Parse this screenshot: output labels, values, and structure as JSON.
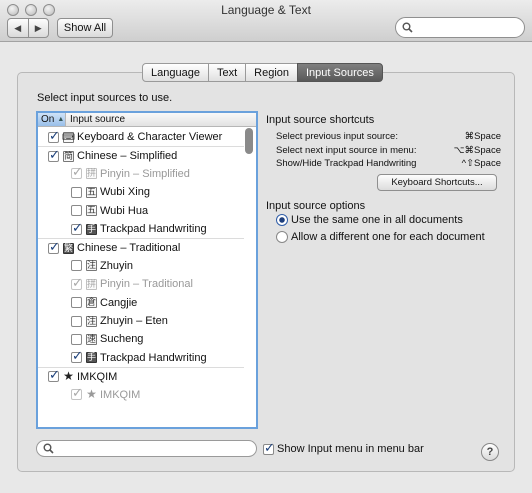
{
  "window": {
    "title": "Language & Text"
  },
  "toolbar": {
    "back_icon": "◀",
    "forward_icon": "▶",
    "show_all_label": "Show All",
    "search_placeholder": ""
  },
  "tabs": [
    {
      "label": "Language",
      "active": false
    },
    {
      "label": "Text",
      "active": false
    },
    {
      "label": "Region",
      "active": false
    },
    {
      "label": "Input Sources",
      "active": true
    }
  ],
  "instruction": "Select input sources to use.",
  "list": {
    "header": {
      "on": "On",
      "sort_indicator": "▲",
      "source": "Input source"
    },
    "items": [
      {
        "label": "Keyboard & Character Viewer",
        "checked": true,
        "disabled": false,
        "child": false,
        "icon": "keyboard-viewer-icon",
        "glyph": "⌨"
      },
      {
        "label": "Chinese – Simplified",
        "checked": true,
        "disabled": false,
        "child": false,
        "icon": "chinese-simplified-icon",
        "glyph": "简"
      },
      {
        "label": "Pinyin – Simplified",
        "checked": true,
        "disabled": true,
        "child": true,
        "icon": "pinyin-simplified-icon",
        "glyph": "拼"
      },
      {
        "label": "Wubi Xing",
        "checked": false,
        "disabled": false,
        "child": true,
        "icon": "wubi-xing-icon",
        "glyph": "五"
      },
      {
        "label": "Wubi Hua",
        "checked": false,
        "disabled": false,
        "child": true,
        "icon": "wubi-hua-icon",
        "glyph": "五"
      },
      {
        "label": "Trackpad Handwriting",
        "checked": true,
        "disabled": false,
        "child": true,
        "icon": "trackpad-handwriting-icon",
        "glyph": "手"
      },
      {
        "label": "Chinese – Traditional",
        "checked": true,
        "disabled": false,
        "child": false,
        "icon": "chinese-traditional-icon",
        "glyph": "繁"
      },
      {
        "label": "Zhuyin",
        "checked": false,
        "disabled": false,
        "child": true,
        "icon": "zhuyin-icon",
        "glyph": "注"
      },
      {
        "label": "Pinyin – Traditional",
        "checked": true,
        "disabled": true,
        "child": true,
        "icon": "pinyin-traditional-icon",
        "glyph": "拼"
      },
      {
        "label": "Cangjie",
        "checked": false,
        "disabled": false,
        "child": true,
        "icon": "cangjie-icon",
        "glyph": "倉"
      },
      {
        "label": "Zhuyin – Eten",
        "checked": false,
        "disabled": false,
        "child": true,
        "icon": "zhuyin-eten-icon",
        "glyph": "注"
      },
      {
        "label": "Sucheng",
        "checked": false,
        "disabled": false,
        "child": true,
        "icon": "sucheng-icon",
        "glyph": "速"
      },
      {
        "label": "Trackpad Handwriting",
        "checked": true,
        "disabled": false,
        "child": true,
        "icon": "trackpad-handwriting-icon",
        "glyph": "手"
      },
      {
        "label": "IMKQIM",
        "checked": true,
        "disabled": false,
        "child": false,
        "icon": "star-icon",
        "glyph": "★"
      },
      {
        "label": "IMKQIM",
        "checked": true,
        "disabled": true,
        "child": true,
        "icon": "star-icon",
        "glyph": "★"
      }
    ]
  },
  "shortcuts": {
    "title": "Input source shortcuts",
    "rows": [
      {
        "label": "Select previous input source:",
        "keys": "⌘Space"
      },
      {
        "label": "Select next input source in menu:",
        "keys": "⌥⌘Space"
      },
      {
        "label": "Show/Hide Trackpad Handwriting",
        "keys": "^⇧Space"
      }
    ],
    "button_label": "Keyboard Shortcuts..."
  },
  "options": {
    "title": "Input source options",
    "radios": [
      {
        "label": "Use the same one in all documents",
        "selected": true
      },
      {
        "label": "Allow a different one for each document",
        "selected": false
      }
    ]
  },
  "bottom": {
    "search_placeholder": "",
    "show_menu_label": "Show Input menu in menu bar",
    "show_menu_checked": true,
    "help_label": "?"
  }
}
